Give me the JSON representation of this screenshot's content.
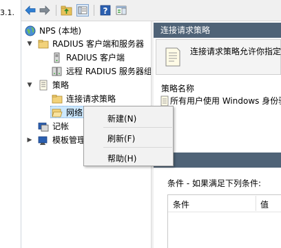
{
  "version_fragment": "3.1.",
  "toolbar": {
    "back_icon": "back-arrow-icon",
    "forward_icon": "forward-arrow-icon",
    "up_icon": "up-folder-icon",
    "show_tree_icon": "show-hide-tree-icon",
    "help_icon": "help-icon",
    "action_pane_icon": "action-pane-icon"
  },
  "tree": {
    "root": "NPS (本地)",
    "radius_group": "RADIUS 客户端和服务器",
    "radius_clients": "RADIUS 客户端",
    "remote_radius": "远程 RADIUS 服务器组",
    "policies": "策略",
    "connection_request_policies": "连接请求策略",
    "network_policies": "网络",
    "accounting": "记帐",
    "templates": "模板管理"
  },
  "right": {
    "header": "连接请求策略",
    "info_text": "连接请求策略允许你指定",
    "policy_name_label": "策略名称",
    "policy_row": "所有用户使用 Windows 身份验",
    "conditions_label": "条件 - 如果满足下列条件:",
    "col_condition": "条件",
    "col_value": "值"
  },
  "context_menu": {
    "new": "新建(N)",
    "refresh": "刷新(F)",
    "help": "帮助(H)"
  },
  "colors": {
    "header_bg": "#4f6377",
    "selection": "#cce8ff",
    "menu_bg": "#f2f2f2",
    "folder": "#e8c25a"
  }
}
